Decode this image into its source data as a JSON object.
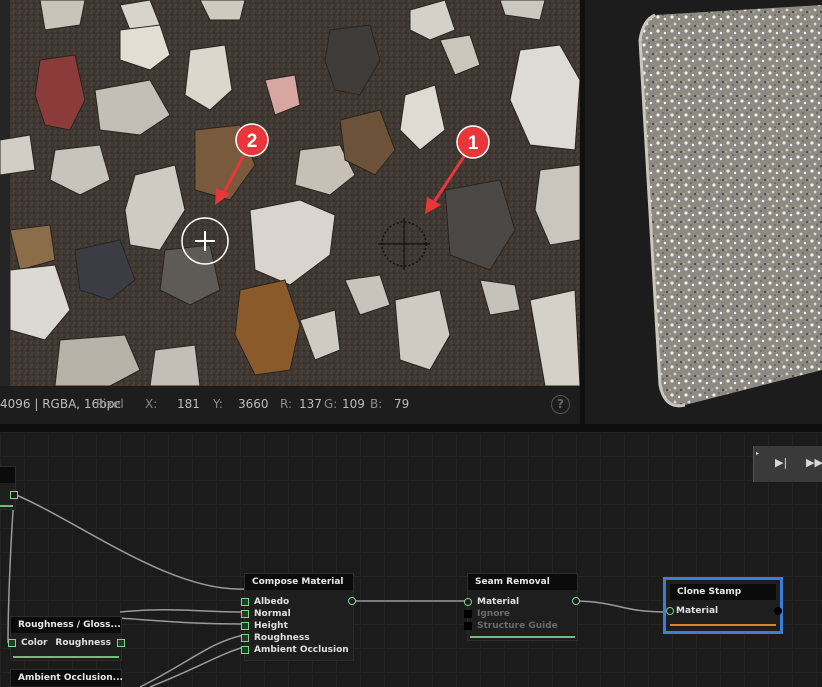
{
  "status_bar": {
    "info": "4096 | RGBA, 16bpc",
    "pixel_label": "Pixel",
    "x_label": "X:",
    "x_value": "181",
    "y_label": "Y:",
    "y_value": "3660",
    "r_label": "R:",
    "r_value": "137",
    "g_label": "G:",
    "g_value": "109",
    "b_label": "B:",
    "b_value": "79",
    "help_glyph": "?"
  },
  "annotations": [
    {
      "label": "1"
    },
    {
      "label": "2"
    }
  ],
  "nodes": {
    "compose": {
      "title": "Compose Material",
      "inputs": [
        "Albedo",
        "Normal",
        "Height",
        "Roughness",
        "Ambient Occlusion"
      ]
    },
    "seam": {
      "title": "Seam Removal",
      "inputs": [
        "Material",
        "Ignore",
        "Structure Guide"
      ]
    },
    "clone": {
      "title": "Clone Stamp",
      "inputs": [
        "Material"
      ]
    },
    "rough": {
      "title": "Roughness / Gloss...",
      "port_in": "Color",
      "port_out": "Roughness"
    },
    "ao": {
      "title": "Ambient Occlusion..."
    }
  },
  "playback": {
    "step_icon": "step-forward-icon",
    "fast_icon": "fast-forward-icon"
  },
  "colors": {
    "accent_green": "#7fd38b",
    "selection_blue": "#3a7fd5",
    "marker_red": "#e8363a",
    "clone_bar": "#d9861c"
  }
}
